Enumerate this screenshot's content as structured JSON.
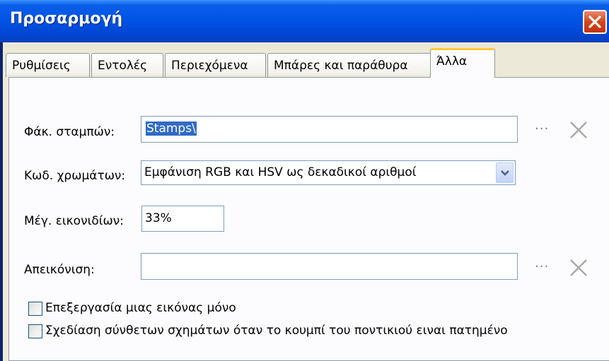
{
  "window": {
    "title": "Προσαρμογή"
  },
  "tabs": [
    {
      "label": "Ρυθμίσεις"
    },
    {
      "label": "Εντολές"
    },
    {
      "label": "Περιεχόμενα"
    },
    {
      "label": "Μπάρες και παράθυρα"
    },
    {
      "label": "Άλλα"
    }
  ],
  "active_tab": "Άλλα",
  "form": {
    "stamps": {
      "label": "Φάκ. σταμπών:",
      "value": "Stamps\\"
    },
    "color_code": {
      "label": "Κωδ. χρωμάτων:",
      "value": "Εμφάνιση RGB και HSV ως δεκαδικοί αριθμοί"
    },
    "icon_size": {
      "label": "Μέγ. εικονιδίων:",
      "value": "33%"
    },
    "display": {
      "label": "Απεικόνιση:",
      "value": ""
    },
    "browse_label": "···"
  },
  "checkboxes": [
    {
      "label": "Επεξεργασία μιας εικόνας μόνο",
      "checked": false
    },
    {
      "label": "Σχεδίαση σύνθετων σχημάτων όταν το κουμπί του ποντικιού ειναι πατημένο",
      "checked": false
    }
  ],
  "colors": {
    "title_bar": "#0054e3",
    "close_button": "#d2451f",
    "active_tab_accent": "#ffc83c",
    "selection": "#316ac5"
  }
}
